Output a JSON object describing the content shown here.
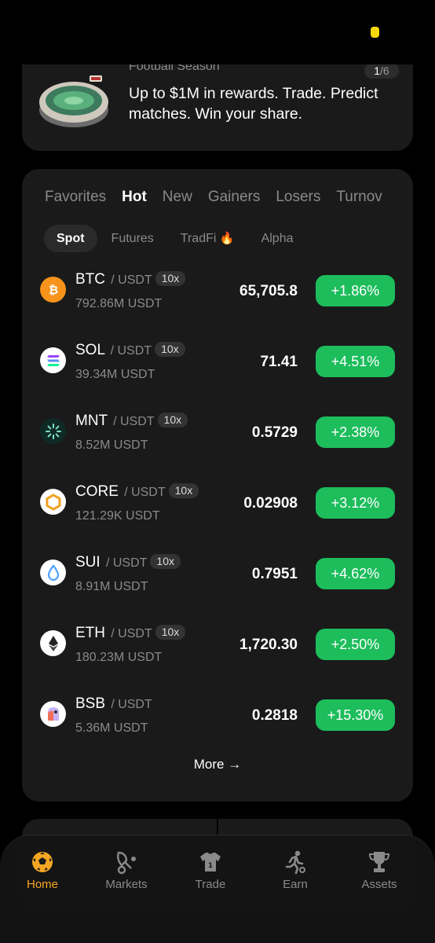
{
  "banner": {
    "kicker": "Football Season",
    "pager_current": "1",
    "pager_total": "/6",
    "text": "Up to $1M in rewards. Trade. Predict matches. Win your share."
  },
  "market": {
    "tabs": [
      "Favorites",
      "Hot",
      "New",
      "Gainers",
      "Losers",
      "Turnov"
    ],
    "active_tab": "Hot",
    "subtabs": [
      "Spot",
      "Futures",
      "TradFi",
      "Alpha"
    ],
    "active_subtab": "Spot",
    "rows": [
      {
        "symbol": "BTC",
        "quote": "/ USDT",
        "leverage": "10x",
        "volume": "792.86M USDT",
        "price": "65,705.8",
        "change": "+1.86%",
        "icon": "bitcoin-icon"
      },
      {
        "symbol": "SOL",
        "quote": "/ USDT",
        "leverage": "10x",
        "volume": "39.34M USDT",
        "price": "71.41",
        "change": "+4.51%",
        "icon": "solana-icon"
      },
      {
        "symbol": "MNT",
        "quote": "/ USDT",
        "leverage": "10x",
        "volume": "8.52M USDT",
        "price": "0.5729",
        "change": "+2.38%",
        "icon": "mantle-icon"
      },
      {
        "symbol": "CORE",
        "quote": "/ USDT",
        "leverage": "10x",
        "volume": "121.29K USDT",
        "price": "0.02908",
        "change": "+3.12%",
        "icon": "core-icon"
      },
      {
        "symbol": "SUI",
        "quote": "/ USDT",
        "leverage": "10x",
        "volume": "8.91M USDT",
        "price": "0.7951",
        "change": "+4.62%",
        "icon": "sui-icon"
      },
      {
        "symbol": "ETH",
        "quote": "/ USDT",
        "leverage": "10x",
        "volume": "180.23M USDT",
        "price": "1,720.30",
        "change": "+2.50%",
        "icon": "ethereum-icon"
      },
      {
        "symbol": "BSB",
        "quote": "/ USDT",
        "leverage": "",
        "volume": "5.36M USDT",
        "price": "0.2818",
        "change": "+15.30%",
        "icon": "bsb-icon"
      }
    ],
    "more_label": "More",
    "positive_color": "#1dbd5c"
  },
  "nav": {
    "items": [
      {
        "label": "Home",
        "icon": "soccer-ball-icon",
        "active": true
      },
      {
        "label": "Markets",
        "icon": "markets-icon",
        "active": false
      },
      {
        "label": "Trade",
        "icon": "jersey-icon",
        "active": false
      },
      {
        "label": "Earn",
        "icon": "runner-icon",
        "active": false
      },
      {
        "label": "Assets",
        "icon": "trophy-icon",
        "active": false
      }
    ],
    "active_color": "#f5a623"
  }
}
